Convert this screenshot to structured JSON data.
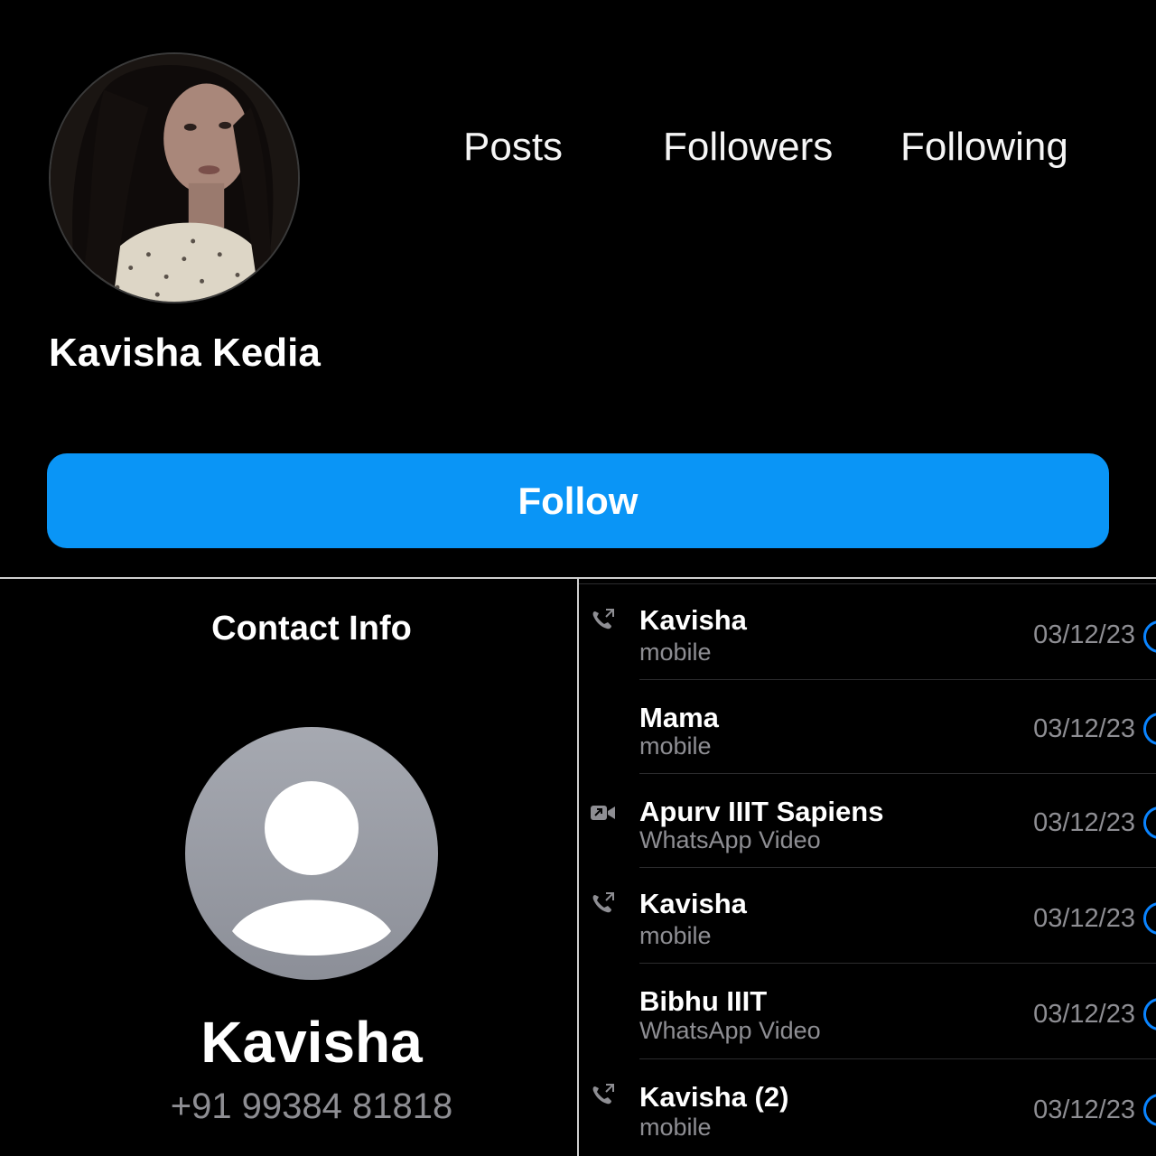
{
  "profile": {
    "name": "Kavisha Kedia",
    "stats": {
      "posts": "Posts",
      "followers": "Followers",
      "following": "Following"
    },
    "follow_label": "Follow",
    "accent": "#0a95f6"
  },
  "contact": {
    "title": "Contact Info",
    "name": "Kavisha",
    "phone": "+91 99384 81818"
  },
  "calls": [
    {
      "name": "Kavisha",
      "type": "mobile",
      "date": "03/12/23",
      "icon": "outgoing-call-icon"
    },
    {
      "name": "Mama",
      "type": "mobile",
      "date": "03/12/23",
      "icon": ""
    },
    {
      "name": "Apurv IIIT Sapiens",
      "type": "WhatsApp Video",
      "date": "03/12/23",
      "icon": "outgoing-video-icon"
    },
    {
      "name": "Kavisha",
      "type": "mobile",
      "date": "03/12/23",
      "icon": "outgoing-call-icon"
    },
    {
      "name": "Bibhu IIIT",
      "type": "WhatsApp Video",
      "date": "03/12/23",
      "icon": ""
    },
    {
      "name": "Kavisha (2)",
      "type": "mobile",
      "date": "03/12/23",
      "icon": "outgoing-call-icon"
    }
  ]
}
